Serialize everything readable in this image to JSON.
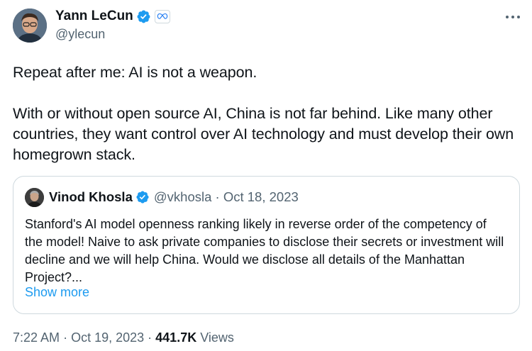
{
  "author": {
    "name": "Yann LeCun",
    "handle": "@ylecun"
  },
  "tweet": {
    "paragraphs": [
      "Repeat after me:  AI is not a weapon.",
      "With or without open source AI, China is not far behind. Like many other countries, they want control over AI technology and must develop their own homegrown stack."
    ],
    "time": "7:22 AM",
    "date": "Oct 19, 2023",
    "views_count": "441.7K",
    "views_label": "Views"
  },
  "quote": {
    "name": "Vinod Khosla",
    "handle": "@vkhosla",
    "date": "Oct 18, 2023",
    "text": "Stanford's AI model openness ranking likely in reverse order of the competency of the model! Naive to ask private companies to disclose their secrets or investment will decline and we will help China. Would we disclose all details of the Manhattan Project?...",
    "show_more": "Show more"
  },
  "colors": {
    "accent": "#1d9bf0",
    "text": "#0f1419",
    "muted": "#536471",
    "border": "#cfd9de"
  },
  "icons": {
    "verified": "verified-badge-icon",
    "affiliation": "meta-infinity-icon",
    "more": "more-options-icon"
  }
}
